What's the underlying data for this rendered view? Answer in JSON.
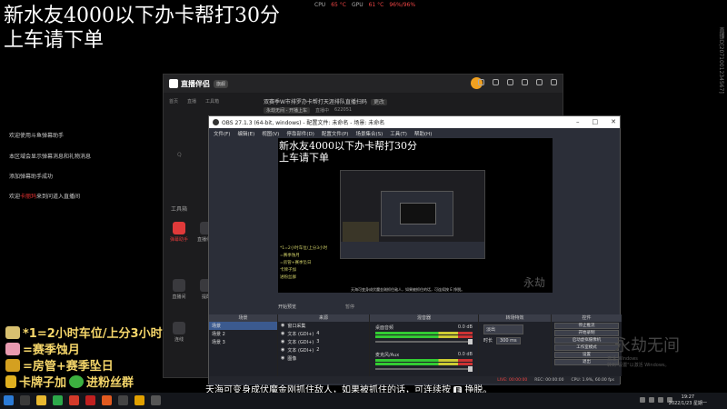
{
  "overlay": {
    "title_line1": "新水友4000以下办卡帮打30分",
    "title_line2": "上车请下单",
    "notices": [
      "欢迎使用斗鱼弹幕助手",
      "本区域会显示弹幕消息和礼物消息",
      "添加弹幕助手成功"
    ],
    "welcome_prefix": "欢迎",
    "welcome_name": "卡丽玛",
    "welcome_suffix": "来到问道入直播间",
    "side_id": "直播ID[2071001234567]",
    "promo": [
      "*1=2小时车位/上分3小时",
      "=赛季蚀月",
      "=房管+赛季坠日",
      "卡牌子加",
      "进粉丝群"
    ]
  },
  "hud": {
    "cpu_label": "CPU",
    "cpu_value": "65 °C",
    "gpu_label": "GPU",
    "gpu_value": "61 °C",
    "fps_value": "96%/96%"
  },
  "companion": {
    "logo": "直播伴侣",
    "badge": "旗舰",
    "tabs": [
      "首页",
      "直播",
      "工具箱"
    ],
    "stream_title": "双赛季W市排罗办卡帮打天涯排队直播扫码",
    "stream_tag": "更改",
    "stream_cat": "永劫无间 - 开播上车",
    "stream_stat": "直播中",
    "stream_id": "622051",
    "search": "Q",
    "tools_label": "工具箱",
    "tools": [
      {
        "label": "弹幕助手",
        "active": true
      },
      {
        "label": "直播伴侣",
        "active": false
      },
      {
        "label": "直播间",
        "active": false
      },
      {
        "label": "提醒",
        "active": false
      },
      {
        "label": "连线",
        "active": false
      }
    ]
  },
  "obs": {
    "title": "OBS 27.1.3 (64-bit, windows) - 配置文件: 未命名 - 场景: 未命名",
    "menu": [
      "文件(F)",
      "编辑(E)",
      "视图(V)",
      "停靠部件(D)",
      "配置文件(P)",
      "场景集合(S)",
      "工具(T)",
      "帮助(H)"
    ],
    "canvas_title_1": "新水友4000以下办卡帮打30分",
    "canvas_title_2": "上车请下单",
    "canvas_lines": [
      "*1=2小时车位/上分3小时",
      "=赛季蚀月",
      "=房管+赛季坠日",
      "卡牌子加",
      "进粉丝群"
    ],
    "canvas_subtitle": "天海可变身成伏魔金刚抓住敌人，如果被抓住的话，可连续按 E 挣脱。",
    "canvas_watermark": "永劫无间",
    "nested_label": "直播伴侣",
    "dock_headers": [
      "场景",
      "来源",
      "混音器",
      "转场特效",
      "控件"
    ],
    "scenes": [
      "场景",
      "场景 2",
      "场景 3"
    ],
    "sources": [
      {
        "name": "窗口采集",
        "tag": ""
      },
      {
        "name": "文本 (GDI+)",
        "tag": "4"
      },
      {
        "name": "文本 (GDI+)",
        "tag": "3"
      },
      {
        "name": "文本 (GDI+)",
        "tag": "2"
      },
      {
        "name": "图像",
        "tag": ""
      }
    ],
    "mixer": [
      {
        "name": "桌面音频",
        "db": "0.0 dB"
      },
      {
        "name": "麦克风/Aux",
        "db": "0.0 dB"
      }
    ],
    "transition_type": "淡出",
    "duration_label": "时长",
    "duration_value": "300 ms",
    "controls": [
      "停止推流",
      "开始录制",
      "启动虚拟摄像机",
      "工作室模式",
      "设置",
      "退出"
    ],
    "status": {
      "live": "LIVE: 00:00:00",
      "rec": "REC: 00:00:00",
      "cpu": "CPU: 1.9%, 60.00 fps"
    },
    "preview_label": "开始预览",
    "preview_sub": "暂停"
  },
  "subtitle": {
    "text_before": "天海可变身成伏魔金刚抓住敌人，如果被抓住的话，可连续按",
    "key": "E",
    "text_after": "挣脱。"
  },
  "taskbar": {
    "time": "19:27",
    "date": "2022/1/23 星期一"
  },
  "windows_watermark": {
    "big": "永劫无间",
    "line1": "激活 Windows",
    "line2": "转到\"设置\"以激活 Windows。"
  }
}
